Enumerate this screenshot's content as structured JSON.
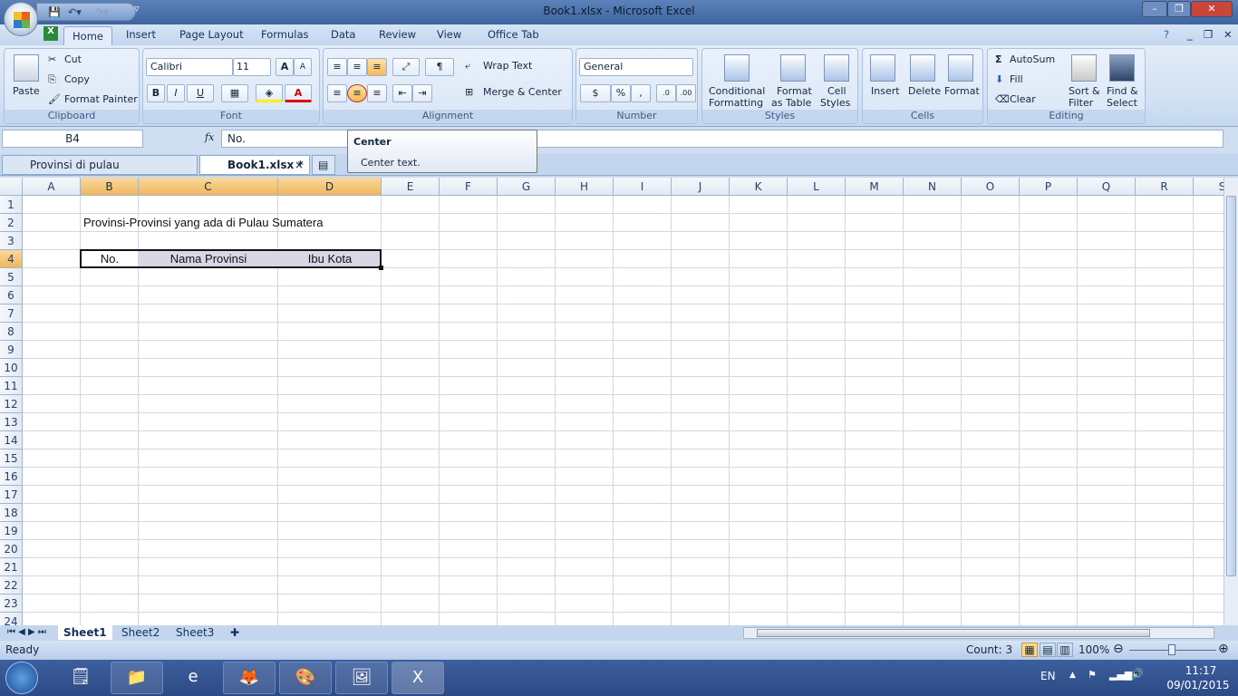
{
  "window": {
    "title": "Book1.xlsx - Microsoft Excel"
  },
  "ribbon_tabs": [
    "Home",
    "Insert",
    "Page Layout",
    "Formulas",
    "Data",
    "Review",
    "View",
    "Office Tab"
  ],
  "clipboard": {
    "paste": "Paste",
    "cut": "Cut",
    "copy": "Copy",
    "format_painter": "Format Painter",
    "label": "Clipboard"
  },
  "font": {
    "name": "Calibri",
    "size": "11",
    "bold": "B",
    "italic": "I",
    "underline": "U",
    "label": "Font"
  },
  "alignment": {
    "wrap_text": "Wrap Text",
    "merge_center": "Merge & Center",
    "label": "Alignment"
  },
  "number": {
    "format": "General",
    "percent": "%",
    "comma": ",",
    "label": "Number"
  },
  "styles": {
    "conditional": [
      "Conditional",
      "Formatting"
    ],
    "format_table": [
      "Format",
      "as Table"
    ],
    "cell_styles": [
      "Cell",
      "Styles"
    ],
    "label": "Styles"
  },
  "cells": {
    "insert": "Insert",
    "delete": "Delete",
    "format": "Format",
    "label": "Cells"
  },
  "editing": {
    "autosum": "AutoSum",
    "fill": "Fill",
    "clear": "Clear",
    "sort": [
      "Sort &",
      "Filter"
    ],
    "find": [
      "Find &",
      "Select"
    ],
    "label": "Editing"
  },
  "formula_bar": {
    "name_box": "B4",
    "fx": "fx",
    "value": "No."
  },
  "tooltip": {
    "title": "Center",
    "body": "Center text."
  },
  "doc_tabs": [
    {
      "label": "Provinsi di pulau Sumatera.xlsx"
    },
    {
      "label": "Book1.xlsx *",
      "active": true
    }
  ],
  "columns": [
    "A",
    "B",
    "C",
    "D",
    "E",
    "F",
    "G",
    "H",
    "I",
    "J",
    "K",
    "L",
    "M",
    "N",
    "O",
    "P",
    "Q",
    "R",
    "S"
  ],
  "rows": [
    "1",
    "2",
    "3",
    "4",
    "5",
    "6",
    "7",
    "8",
    "9",
    "10",
    "11",
    "12",
    "13",
    "14",
    "15",
    "16",
    "17",
    "18",
    "19",
    "20",
    "21",
    "22",
    "23",
    "24"
  ],
  "cells_data": {
    "B2": "Provinsi-Provinsi yang ada di Pulau Sumatera",
    "B4": "No.",
    "C4": "Nama Provinsi",
    "D4": "Ibu Kota"
  },
  "selected_range": "B4:D4",
  "sheets": [
    "Sheet1",
    "Sheet2",
    "Sheet3"
  ],
  "status": {
    "ready": "Ready",
    "count": "Count: 3",
    "zoom": "100%"
  },
  "taskbar": {
    "lang": "EN",
    "time": "11:17",
    "date": "09/01/2015"
  },
  "colors": {
    "selected_header": "#f1b65a",
    "selection_fill": "#d9d7e5",
    "accent": "#3d64a0"
  }
}
